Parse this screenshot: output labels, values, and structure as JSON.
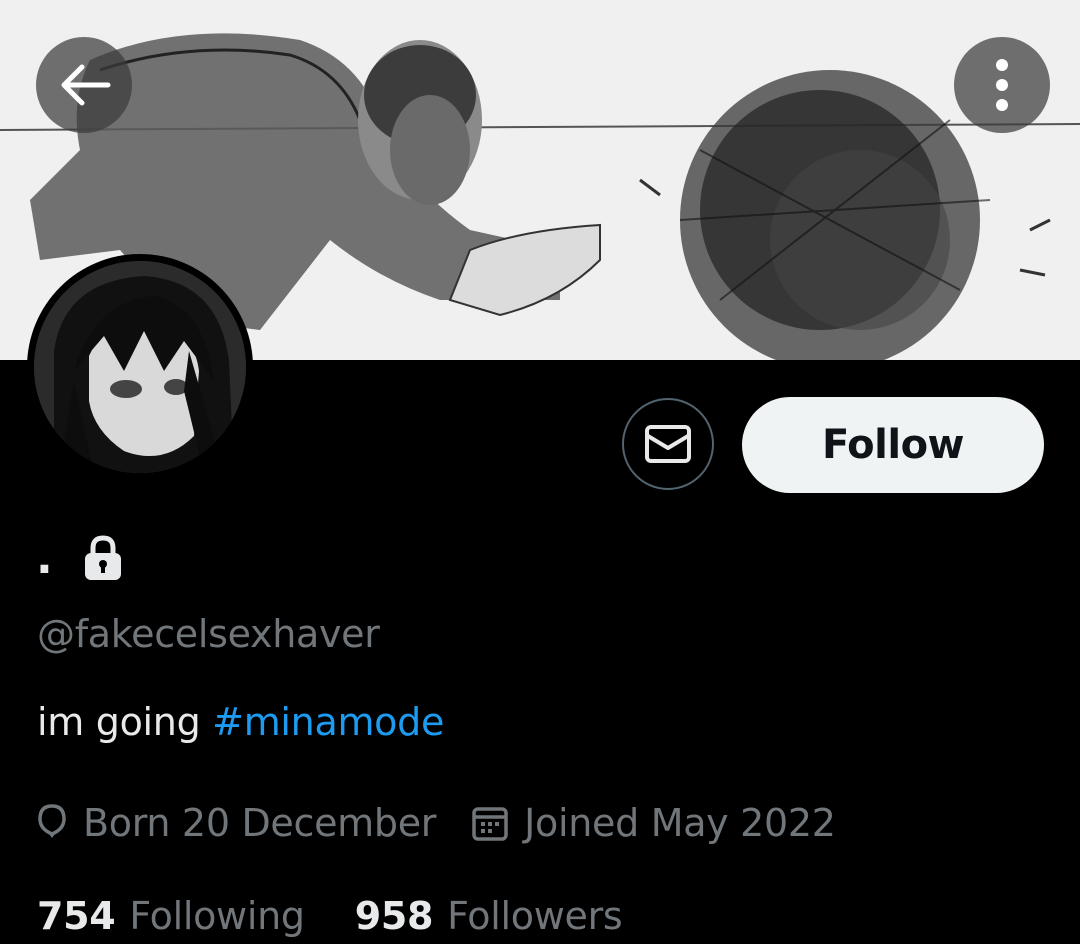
{
  "header": {
    "back_icon": "arrow-left-icon",
    "more_icon": "vertical-ellipsis-icon"
  },
  "banner": {
    "description_icon": "banner-image"
  },
  "actions": {
    "message_icon": "envelope-icon",
    "follow_label": "Follow"
  },
  "profile": {
    "display_name": ".",
    "protected_icon": "lock-icon",
    "handle": "@fakecelsexhaver",
    "bio_text": "im going ",
    "bio_hashtag": "#minamode",
    "birthday_icon": "balloon-icon",
    "birthday": "Born 20 December",
    "joined_icon": "calendar-icon",
    "joined": "Joined May 2022"
  },
  "stats": {
    "following_count": "754",
    "following_label": "Following",
    "followers_count": "958",
    "followers_label": "Followers"
  },
  "colors": {
    "background": "#000000",
    "primary_text": "#e7e9ea",
    "secondary_text": "#71767b",
    "accent": "#1d9bf0",
    "follow_button_bg": "#eff3f4",
    "follow_button_text": "#0f1419"
  }
}
